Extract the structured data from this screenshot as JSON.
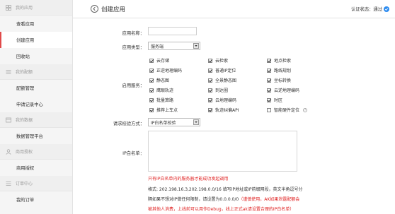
{
  "sidebar": {
    "groups": [
      {
        "label": "我的应用",
        "items": [
          {
            "label": "查看应用"
          },
          {
            "label": "创建应用"
          },
          {
            "label": "回收站"
          }
        ]
      },
      {
        "label": "我的配额",
        "items": [
          {
            "label": "配额管理"
          },
          {
            "label": "申请记录中心"
          }
        ]
      },
      {
        "label": "我的数据",
        "items": [
          {
            "label": "数据管理平台"
          }
        ]
      },
      {
        "label": "商用授权",
        "items": [
          {
            "label": "商用授权"
          }
        ]
      },
      {
        "label": "订单中心",
        "items": [
          {
            "label": "我的订单"
          }
        ]
      }
    ]
  },
  "header": {
    "title": "创建应用",
    "auth_status": "认证状态：通过"
  },
  "form": {
    "app_name_label": "应用名称：",
    "app_name_value": "",
    "app_type_label": "应用类型：",
    "app_type_value": "服务端",
    "services_label": "启用服务：",
    "services": [
      {
        "label": "云存储",
        "checked": true
      },
      {
        "label": "云检索",
        "checked": true
      },
      {
        "label": "地点检索",
        "checked": true
      },
      {
        "label": "正逆地理编码",
        "checked": true
      },
      {
        "label": "普通IP定位",
        "checked": true
      },
      {
        "label": "路线规划",
        "checked": true
      },
      {
        "label": "静态图",
        "checked": true
      },
      {
        "label": "全景静态图",
        "checked": true
      },
      {
        "label": "坐标转换",
        "checked": true
      },
      {
        "label": "鹰眼轨迹",
        "checked": true
      },
      {
        "label": "到达圈",
        "checked": true
      },
      {
        "label": "云逆地理编码",
        "checked": true
      },
      {
        "label": "批量算路",
        "checked": true
      },
      {
        "label": "云地理编码",
        "checked": true
      },
      {
        "label": "时区",
        "checked": true
      },
      {
        "label": "推荐上车点",
        "checked": true
      },
      {
        "label": "轨迹纠偏API",
        "checked": true
      },
      {
        "label": "智能硬件定位",
        "checked": false
      }
    ],
    "help_glyph": "?",
    "verify_label": "请求校验方式：",
    "verify_value": "IP白名单校验",
    "whitelist_label": "IP白名单：",
    "whitelist_value": "",
    "whitelist_hint": "只有IP白名单内的服务器才能成功发起调用",
    "note_line1": "格式: 202.198.16.3,202.198.0.0/16 填写IP地址或IP前缀网段，英文半角逗号分",
    "note_line2_plain": "隔如果不想对IP做任何限制，请设置为0.0.0.0/0",
    "note_line2_red": "（谨慎使用，AK如果泄露配额会",
    "note_line3_red": "被其他人消费，上线前可以用作Debug，线上正式ak请设置合理的IP白名单）"
  },
  "colors": {
    "accent_red": "#e02020",
    "active_bar": "#e04a4a",
    "auth_blue": "#2d8cf0"
  }
}
